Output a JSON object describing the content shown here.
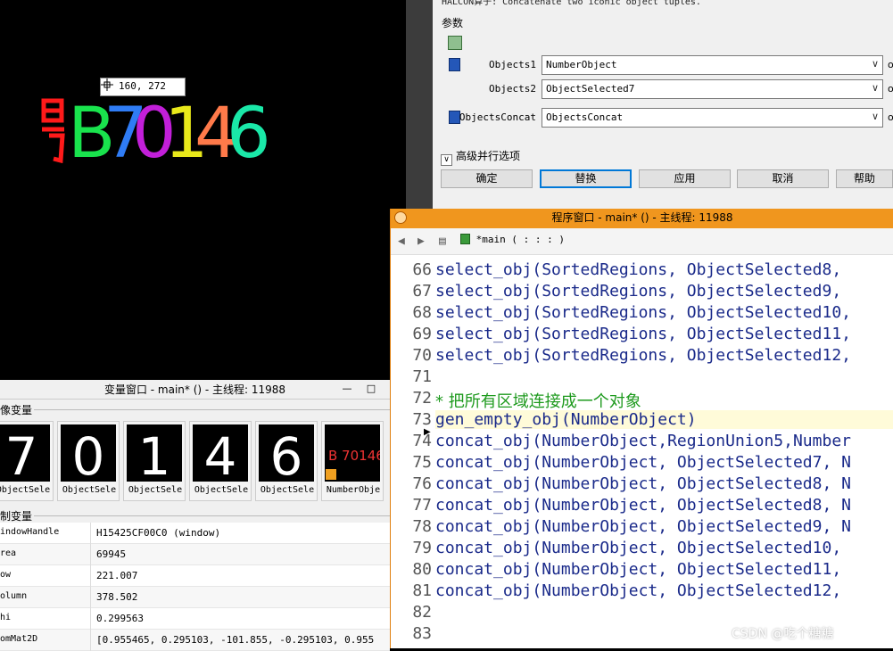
{
  "graphics": {
    "coord_readout": "160, 272",
    "chars": [
      {
        "glyph": "B",
        "color": "#19e34d"
      },
      {
        "glyph": "7",
        "color": "#2f7cf5"
      },
      {
        "glyph": "0",
        "color": "#c21fd9"
      },
      {
        "glyph": "1",
        "color": "#e8e81a"
      },
      {
        "glyph": "4",
        "color": "#ff7a4a"
      },
      {
        "glyph": "6",
        "color": "#1ae8a8"
      }
    ]
  },
  "dialog": {
    "cut_title": "HALCON算子: Concatenate two iconic object tuples.",
    "group_label": "参数",
    "params": [
      {
        "label": "Objects1",
        "value": "NumberObject",
        "out": "o"
      },
      {
        "label": "Objects2",
        "value": "ObjectSelected7",
        "out": "o"
      },
      {
        "label": "ObjectsConcat",
        "value": "ObjectsConcat",
        "out": "o"
      }
    ],
    "advanced_label": "高级并行选项",
    "buttons": [
      "确定",
      "替换",
      "应用",
      "取消",
      "帮助"
    ]
  },
  "variables": {
    "title": "变量窗口 - main* () - 主线程: 11988",
    "minimize": "—",
    "maximize": "□",
    "iconic_section": "像变量",
    "control_section": "制变量",
    "thumbnails": [
      {
        "name": "ObjectSele",
        "glyph": "7"
      },
      {
        "name": "ObjectSele",
        "glyph": "0"
      },
      {
        "name": "ObjectSele",
        "glyph": "1"
      },
      {
        "name": "ObjectSele",
        "glyph": "4"
      },
      {
        "name": "ObjectSele",
        "glyph": "6"
      },
      {
        "name": "NumberObje",
        "glyph": "B 70146"
      }
    ],
    "controls": [
      {
        "name": "indowHandle",
        "value": "H15425CF00C0 (window)"
      },
      {
        "name": "rea",
        "value": "69945"
      },
      {
        "name": "ow",
        "value": "221.007"
      },
      {
        "name": "olumn",
        "value": "378.502"
      },
      {
        "name": "hi",
        "value": "0.299563"
      },
      {
        "name": "omMat2D",
        "value": "[0.955465, 0.295103, -101.855, -0.295103, 0.955"
      }
    ]
  },
  "program": {
    "title": "程序窗口 - main* () - 主线程: 11988",
    "procedure": "*main ( : : : )",
    "lines": [
      {
        "num": "66",
        "text": "select_obj(SortedRegions, ObjectSelected8,",
        "kind": "code"
      },
      {
        "num": "67",
        "text": "select_obj(SortedRegions, ObjectSelected9,",
        "kind": "code"
      },
      {
        "num": "68",
        "text": "select_obj(SortedRegions, ObjectSelected10,",
        "kind": "code"
      },
      {
        "num": "69",
        "text": "select_obj(SortedRegions, ObjectSelected11,",
        "kind": "code"
      },
      {
        "num": "70",
        "text": "select_obj(SortedRegions, ObjectSelected12,",
        "kind": "code"
      },
      {
        "num": "71",
        "text": "",
        "kind": "code"
      },
      {
        "num": "72",
        "text": "* 把所有区域连接成一个对象",
        "kind": "comment"
      },
      {
        "num": "73",
        "text": "gen_empty_obj(NumberObject)",
        "kind": "current"
      },
      {
        "num": "74",
        "text": "concat_obj(NumberObject,RegionUnion5,Number",
        "kind": "code"
      },
      {
        "num": "75",
        "text": "concat_obj(NumberObject, ObjectSelected7, N",
        "kind": "code"
      },
      {
        "num": "76",
        "text": "concat_obj(NumberObject, ObjectSelected8, N",
        "kind": "code"
      },
      {
        "num": "77",
        "text": "concat_obj(NumberObject, ObjectSelected8, N",
        "kind": "code"
      },
      {
        "num": "78",
        "text": "concat_obj(NumberObject, ObjectSelected9, N",
        "kind": "code"
      },
      {
        "num": "79",
        "text": "concat_obj(NumberObject, ObjectSelected10,",
        "kind": "code"
      },
      {
        "num": "80",
        "text": "concat_obj(NumberObject, ObjectSelected11,",
        "kind": "code"
      },
      {
        "num": "81",
        "text": "concat_obj(NumberObject, ObjectSelected12,",
        "kind": "code"
      },
      {
        "num": "82",
        "text": "",
        "kind": "code"
      },
      {
        "num": "83",
        "text": "",
        "kind": "code"
      }
    ]
  },
  "watermark": "CSDN @吃个糖糖"
}
